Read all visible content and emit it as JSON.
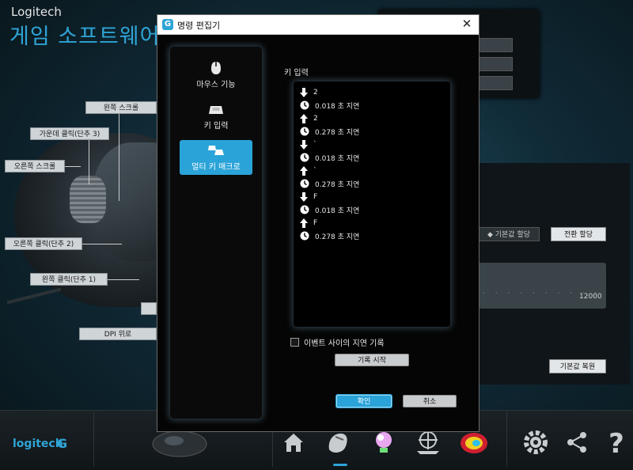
{
  "app": {
    "brand": "Logitech",
    "title": "게임 소프트웨어"
  },
  "mouse_labels": {
    "left_scroll": "왼쪽 스크롤",
    "middle_click": "가운데 클릭(단추 3)",
    "right_scroll": "오른쪽 스크롤",
    "right_click": "오른쪽 클릭(단추 2)",
    "left_click": "왼쪽 클릭(단추 1)",
    "dpi_shift": "DPI 위로"
  },
  "right_panel": {
    "default_assign": "◆ 기본값 할당",
    "toggle_assign": "전환 할당",
    "slider_value": "12000",
    "slider_ticks": "· · · · · · · · · ·",
    "restore_default": "기본값 복원"
  },
  "bottom": {
    "logo_text": "logitech",
    "logo_mark": "G"
  },
  "dialog": {
    "title": "명령 편집기",
    "close_glyph": "✕",
    "categories": [
      {
        "label": "마우스 기능",
        "icon": "mouse-icon",
        "active": false
      },
      {
        "label": "키 입력",
        "icon": "key-icon",
        "active": false
      },
      {
        "label": "멀티 키 매크로",
        "icon": "multi-key-icon",
        "active": true
      }
    ],
    "events_label": "키 입력",
    "events": [
      {
        "type": "down",
        "text": "2"
      },
      {
        "type": "delay",
        "text": "0.018 초 지연"
      },
      {
        "type": "up",
        "text": "2"
      },
      {
        "type": "delay",
        "text": "0.278 초 지연"
      },
      {
        "type": "down",
        "text": "`"
      },
      {
        "type": "delay",
        "text": "0.018 초 지연"
      },
      {
        "type": "up",
        "text": "`"
      },
      {
        "type": "delay",
        "text": "0.278 초 지연"
      },
      {
        "type": "down",
        "text": "F"
      },
      {
        "type": "delay",
        "text": "0.018 초 지연"
      },
      {
        "type": "up",
        "text": "F"
      },
      {
        "type": "delay",
        "text": "0.278 초 지연"
      }
    ],
    "record_delays_label": "이벤트 사이의 지연 기록",
    "record_delays_checked": false,
    "start_record": "기록 시작",
    "ok": "확인",
    "cancel": "취소"
  },
  "colors": {
    "accent": "#2aa3d8",
    "title_blue": "#2fa4d6",
    "dialog_bg": "#050505"
  }
}
